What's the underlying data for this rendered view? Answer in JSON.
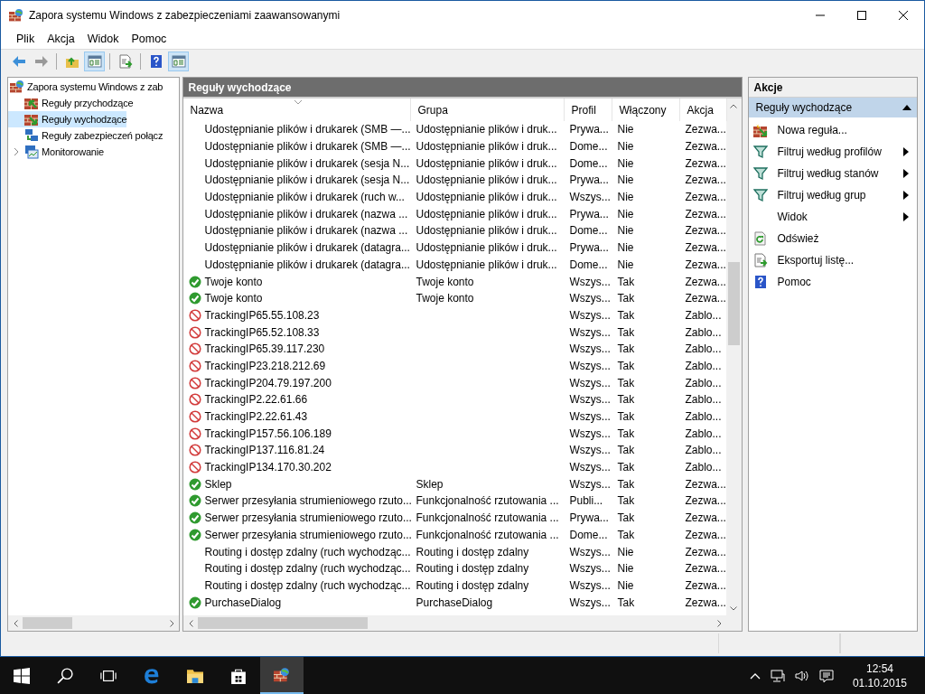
{
  "window": {
    "title": "Zapora systemu Windows z zabezpieczeniami zaawansowanymi"
  },
  "menu": [
    "Plik",
    "Akcja",
    "Widok",
    "Pomoc"
  ],
  "toolbar_groups": [
    {
      "buttons": [
        {
          "kind": "back",
          "disabled": false,
          "pressed": false
        },
        {
          "kind": "forward",
          "disabled": true,
          "pressed": false
        }
      ]
    },
    {
      "buttons": [
        {
          "kind": "up",
          "disabled": false,
          "pressed": false
        },
        {
          "kind": "tree-pane",
          "disabled": false,
          "pressed": true
        }
      ]
    },
    {
      "buttons": [
        {
          "kind": "export",
          "disabled": false,
          "pressed": false
        }
      ]
    },
    {
      "buttons": [
        {
          "kind": "help",
          "disabled": false,
          "pressed": false
        },
        {
          "kind": "action-pane",
          "disabled": false,
          "pressed": true
        }
      ]
    }
  ],
  "tree": {
    "label": "Zapora systemu Windows z zab",
    "children": [
      {
        "label": "Reguły przychodzące",
        "kind": "inbound",
        "selected": false
      },
      {
        "label": "Reguły wychodzące",
        "kind": "outbound",
        "selected": true
      },
      {
        "label": "Reguły zabezpieczeń połącz",
        "kind": "security",
        "selected": false
      },
      {
        "label": "Monitorowanie",
        "kind": "monitor",
        "selected": false,
        "expanded": false
      }
    ]
  },
  "rules_panel": {
    "title": "Reguły wychodzące",
    "columns": [
      "Nazwa",
      "Grupa",
      "Profil",
      "Włączony",
      "Akcja"
    ],
    "rows": [
      {
        "kind": "none",
        "name": "Udostępnianie plików i drukarek (SMB —...",
        "group": "Udostępnianie plików i druk...",
        "profile": "Prywa...",
        "enabled": "Nie",
        "action": "Zezwa..."
      },
      {
        "kind": "none",
        "name": "Udostępnianie plików i drukarek (SMB —...",
        "group": "Udostępnianie plików i druk...",
        "profile": "Dome...",
        "enabled": "Nie",
        "action": "Zezwa..."
      },
      {
        "kind": "none",
        "name": "Udostępnianie plików i drukarek (sesja N...",
        "group": "Udostępnianie plików i druk...",
        "profile": "Dome...",
        "enabled": "Nie",
        "action": "Zezwa..."
      },
      {
        "kind": "none",
        "name": "Udostępnianie plików i drukarek (sesja N...",
        "group": "Udostępnianie plików i druk...",
        "profile": "Prywa...",
        "enabled": "Nie",
        "action": "Zezwa..."
      },
      {
        "kind": "none",
        "name": "Udostępnianie plików i drukarek (ruch w...",
        "group": "Udostępnianie plików i druk...",
        "profile": "Wszys...",
        "enabled": "Nie",
        "action": "Zezwa..."
      },
      {
        "kind": "none",
        "name": "Udostępnianie plików i drukarek (nazwa ...",
        "group": "Udostępnianie plików i druk...",
        "profile": "Prywa...",
        "enabled": "Nie",
        "action": "Zezwa..."
      },
      {
        "kind": "none",
        "name": "Udostępnianie plików i drukarek (nazwa ...",
        "group": "Udostępnianie plików i druk...",
        "profile": "Dome...",
        "enabled": "Nie",
        "action": "Zezwa..."
      },
      {
        "kind": "none",
        "name": "Udostępnianie plików i drukarek (datagra...",
        "group": "Udostępnianie plików i druk...",
        "profile": "Prywa...",
        "enabled": "Nie",
        "action": "Zezwa..."
      },
      {
        "kind": "none",
        "name": "Udostępnianie plików i drukarek (datagra...",
        "group": "Udostępnianie plików i druk...",
        "profile": "Dome...",
        "enabled": "Nie",
        "action": "Zezwa..."
      },
      {
        "kind": "allow",
        "name": "Twoje konto",
        "group": "Twoje konto",
        "profile": "Wszys...",
        "enabled": "Tak",
        "action": "Zezwa..."
      },
      {
        "kind": "allow",
        "name": "Twoje konto",
        "group": "Twoje konto",
        "profile": "Wszys...",
        "enabled": "Tak",
        "action": "Zezwa..."
      },
      {
        "kind": "block",
        "name": "TrackingIP65.55.108.23",
        "profile": "Wszys...",
        "enabled": "Tak",
        "action": "Zablo..."
      },
      {
        "kind": "block",
        "name": "TrackingIP65.52.108.33",
        "profile": "Wszys...",
        "enabled": "Tak",
        "action": "Zablo..."
      },
      {
        "kind": "block",
        "name": "TrackingIP65.39.117.230",
        "profile": "Wszys...",
        "enabled": "Tak",
        "action": "Zablo..."
      },
      {
        "kind": "block",
        "name": "TrackingIP23.218.212.69",
        "profile": "Wszys...",
        "enabled": "Tak",
        "action": "Zablo..."
      },
      {
        "kind": "block",
        "name": "TrackingIP204.79.197.200",
        "profile": "Wszys...",
        "enabled": "Tak",
        "action": "Zablo..."
      },
      {
        "kind": "block",
        "name": "TrackingIP2.22.61.66",
        "profile": "Wszys...",
        "enabled": "Tak",
        "action": "Zablo..."
      },
      {
        "kind": "block",
        "name": "TrackingIP2.22.61.43",
        "profile": "Wszys...",
        "enabled": "Tak",
        "action": "Zablo..."
      },
      {
        "kind": "block",
        "name": "TrackingIP157.56.106.189",
        "profile": "Wszys...",
        "enabled": "Tak",
        "action": "Zablo..."
      },
      {
        "kind": "block",
        "name": "TrackingIP137.116.81.24",
        "profile": "Wszys...",
        "enabled": "Tak",
        "action": "Zablo..."
      },
      {
        "kind": "block",
        "name": "TrackingIP134.170.30.202",
        "profile": "Wszys...",
        "enabled": "Tak",
        "action": "Zablo..."
      },
      {
        "kind": "allow",
        "name": "Sklep",
        "group": "Sklep",
        "profile": "Wszys...",
        "enabled": "Tak",
        "action": "Zezwa..."
      },
      {
        "kind": "allow",
        "name": "Serwer przesyłania strumieniowego rzuto...",
        "group": "Funkcjonalność rzutowania ...",
        "profile": "Publi...",
        "enabled": "Tak",
        "action": "Zezwa..."
      },
      {
        "kind": "allow",
        "name": "Serwer przesyłania strumieniowego rzuto...",
        "group": "Funkcjonalność rzutowania ...",
        "profile": "Prywa...",
        "enabled": "Tak",
        "action": "Zezwa..."
      },
      {
        "kind": "allow",
        "name": "Serwer przesyłania strumieniowego rzuto...",
        "group": "Funkcjonalność rzutowania ...",
        "profile": "Dome...",
        "enabled": "Tak",
        "action": "Zezwa..."
      },
      {
        "kind": "none",
        "name": "Routing i dostęp zdalny (ruch wychodząc...",
        "group": "Routing i dostęp zdalny",
        "profile": "Wszys...",
        "enabled": "Nie",
        "action": "Zezwa..."
      },
      {
        "kind": "none",
        "name": "Routing i dostęp zdalny (ruch wychodząc...",
        "group": "Routing i dostęp zdalny",
        "profile": "Wszys...",
        "enabled": "Nie",
        "action": "Zezwa..."
      },
      {
        "kind": "none",
        "name": "Routing i dostęp zdalny (ruch wychodząc...",
        "group": "Routing i dostęp zdalny",
        "profile": "Wszys...",
        "enabled": "Nie",
        "action": "Zezwa..."
      },
      {
        "kind": "allow",
        "name": "PurchaseDialog",
        "group": "PurchaseDialog",
        "profile": "Wszys...",
        "enabled": "Tak",
        "action": "Zezwa..."
      }
    ]
  },
  "actions_panel": {
    "title": "Akcje",
    "section": {
      "label": "Reguły wychodzące",
      "expanded": true
    },
    "items": [
      {
        "kind": "new-rule",
        "label": "Nowa reguła...",
        "submenu": false
      },
      {
        "kind": "filter",
        "label": "Filtruj według profilów",
        "submenu": true
      },
      {
        "kind": "filter",
        "label": "Filtruj według stanów",
        "submenu": true
      },
      {
        "kind": "filter",
        "label": "Filtruj według grup",
        "submenu": true
      },
      {
        "kind": "none",
        "label": "Widok",
        "submenu": true
      },
      {
        "kind": "refresh",
        "label": "Odśwież",
        "submenu": false
      },
      {
        "kind": "export",
        "label": "Eksportuj listę...",
        "submenu": false
      },
      {
        "kind": "help",
        "label": "Pomoc",
        "submenu": false
      }
    ]
  },
  "taskbar": {
    "items": [
      {
        "kind": "start",
        "selected": false
      },
      {
        "kind": "search",
        "selected": false
      },
      {
        "kind": "task-view",
        "selected": false
      },
      {
        "kind": "browser",
        "selected": false
      },
      {
        "kind": "folder",
        "selected": false
      },
      {
        "kind": "store",
        "selected": false
      },
      {
        "kind": "firewall",
        "selected": true
      }
    ],
    "clock": {
      "time": "12:54",
      "date": "01.10.2015"
    }
  }
}
